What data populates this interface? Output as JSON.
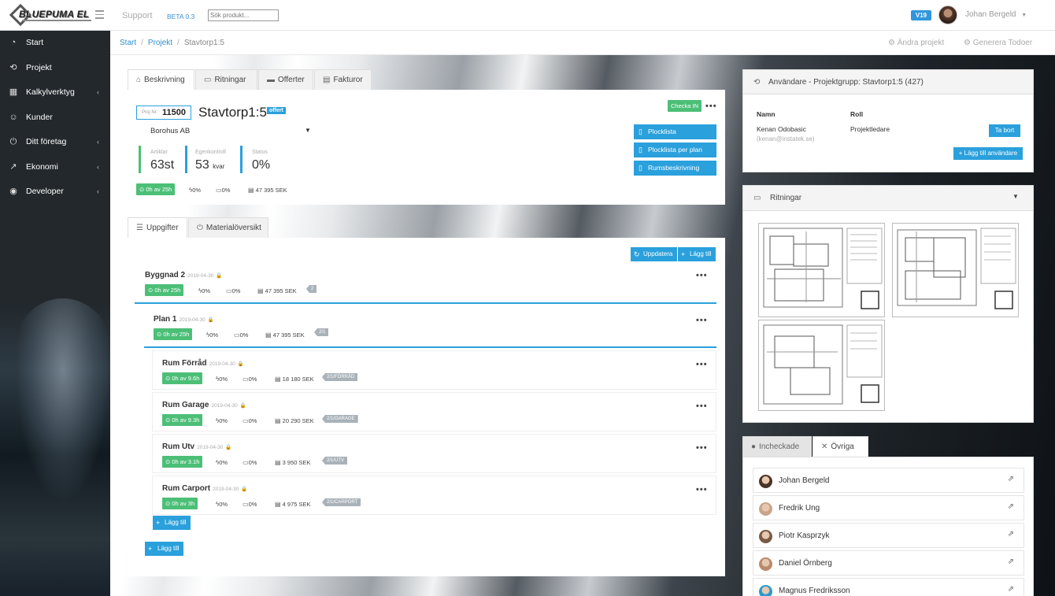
{
  "topbar": {
    "brand": "BLUEPUMA EL",
    "support": "Support",
    "beta": "BETA 0.3",
    "search_placeholder": "Sök produkt...",
    "version": "V19",
    "user": "Johan Bergeld"
  },
  "sidebar": {
    "items": [
      {
        "label": "Start",
        "icon": "dashboard-icon",
        "chevron": false
      },
      {
        "label": "Projekt",
        "icon": "history-icon",
        "chevron": false
      },
      {
        "label": "Kalkylverktyg",
        "icon": "calculator-icon",
        "chevron": true
      },
      {
        "label": "Kunder",
        "icon": "users-icon",
        "chevron": false
      },
      {
        "label": "Ditt företag",
        "icon": "power-icon",
        "chevron": true
      },
      {
        "label": "Ekonomi",
        "icon": "chart-icon",
        "chevron": true
      },
      {
        "label": "Developer",
        "icon": "eye-icon",
        "chevron": true
      }
    ]
  },
  "breadcrumb": [
    "Start",
    "Projekt",
    "Stavtorp1:5"
  ],
  "toolbar": {
    "edit_project": "Ändra projekt",
    "generate_todos": "Generera Todoer"
  },
  "project_tabs": [
    "Beskrivning",
    "Ritningar",
    "Offerter",
    "Fakturor"
  ],
  "project": {
    "proj_nr_label": "Proj Nr:",
    "proj_nr": "11500",
    "name": "Stavtorp1:5",
    "badge": "offert",
    "customer": "Borohus AB",
    "checkin": "Checka IN",
    "stats": [
      {
        "label": "Artiklar",
        "value": "63st",
        "unit": ""
      },
      {
        "label": "Egenkontroll",
        "value": "53",
        "unit": "kvar"
      },
      {
        "label": "Status",
        "value": "0%",
        "unit": ""
      }
    ],
    "hours": "0h av 25h",
    "pct1": "0%",
    "pct2": "0%",
    "cost": "47 395 SEK",
    "buttons": [
      "Plocklista",
      "Plocklista per plan",
      "Rumsbeskrivning"
    ]
  },
  "task_tabs": [
    "Uppgifter",
    "Materialöversikt"
  ],
  "task_actions": {
    "update": "Uppdatera",
    "add": "Lägg till"
  },
  "tasks": {
    "building": {
      "name": "Byggnad 2",
      "date": "2019-04-30",
      "hours": "0h av 25h",
      "p1": "0%",
      "p2": "0%",
      "cost": "47 395 SEK",
      "tag": "2"
    },
    "plan": {
      "name": "Plan 1",
      "date": "2019-04-30",
      "hours": "0h av 25h",
      "p1": "0%",
      "p2": "0%",
      "cost": "47 395 SEK",
      "tag": "2/1"
    },
    "rooms": [
      {
        "name": "Rum Förråd",
        "date": "2019-04-30",
        "hours": "0h av 9.6h",
        "p1": "0%",
        "p2": "0%",
        "cost": "18 180 SEK",
        "tag": "2/1/FÖRRÅD"
      },
      {
        "name": "Rum Garage",
        "date": "2019-04-30",
        "hours": "0h av 9.3h",
        "p1": "0%",
        "p2": "0%",
        "cost": "20 290 SEK",
        "tag": "2/1/GARAGE"
      },
      {
        "name": "Rum Utv",
        "date": "2019-04-30",
        "hours": "0h av 3.1h",
        "p1": "0%",
        "p2": "0%",
        "cost": "3 950 SEK",
        "tag": "2/1/UTV"
      },
      {
        "name": "Rum Carport",
        "date": "2019-04-30",
        "hours": "0h av 3h",
        "p1": "0%",
        "p2": "0%",
        "cost": "4 975 SEK",
        "tag": "2/1/CARPORT"
      }
    ],
    "add_room": "Lägg till",
    "add_building": "Lägg till"
  },
  "users_panel": {
    "title": "Användare - Projektgrupp: Stavtorp1:5 (427)",
    "col_name": "Namn",
    "col_role": "Roll",
    "user_name": "Kenan Odobasic",
    "user_email": "(kenan@instatek.se)",
    "user_role": "Projektledare",
    "remove": "Ta bort",
    "add_user": "Lägg till användare"
  },
  "drawings_panel": {
    "title": "Ritningar"
  },
  "checkin_tabs": [
    "Incheckade",
    "Övriga"
  ],
  "people": [
    "Johan Bergeld",
    "Fredrik Ung",
    "Piotr Kasprzyk",
    "Daniel Örnberg",
    "Magnus Fredriksson"
  ],
  "colors": {
    "accent_blue": "#2aa0dc",
    "green": "#4cbf77",
    "sidebar": "#22282c"
  }
}
